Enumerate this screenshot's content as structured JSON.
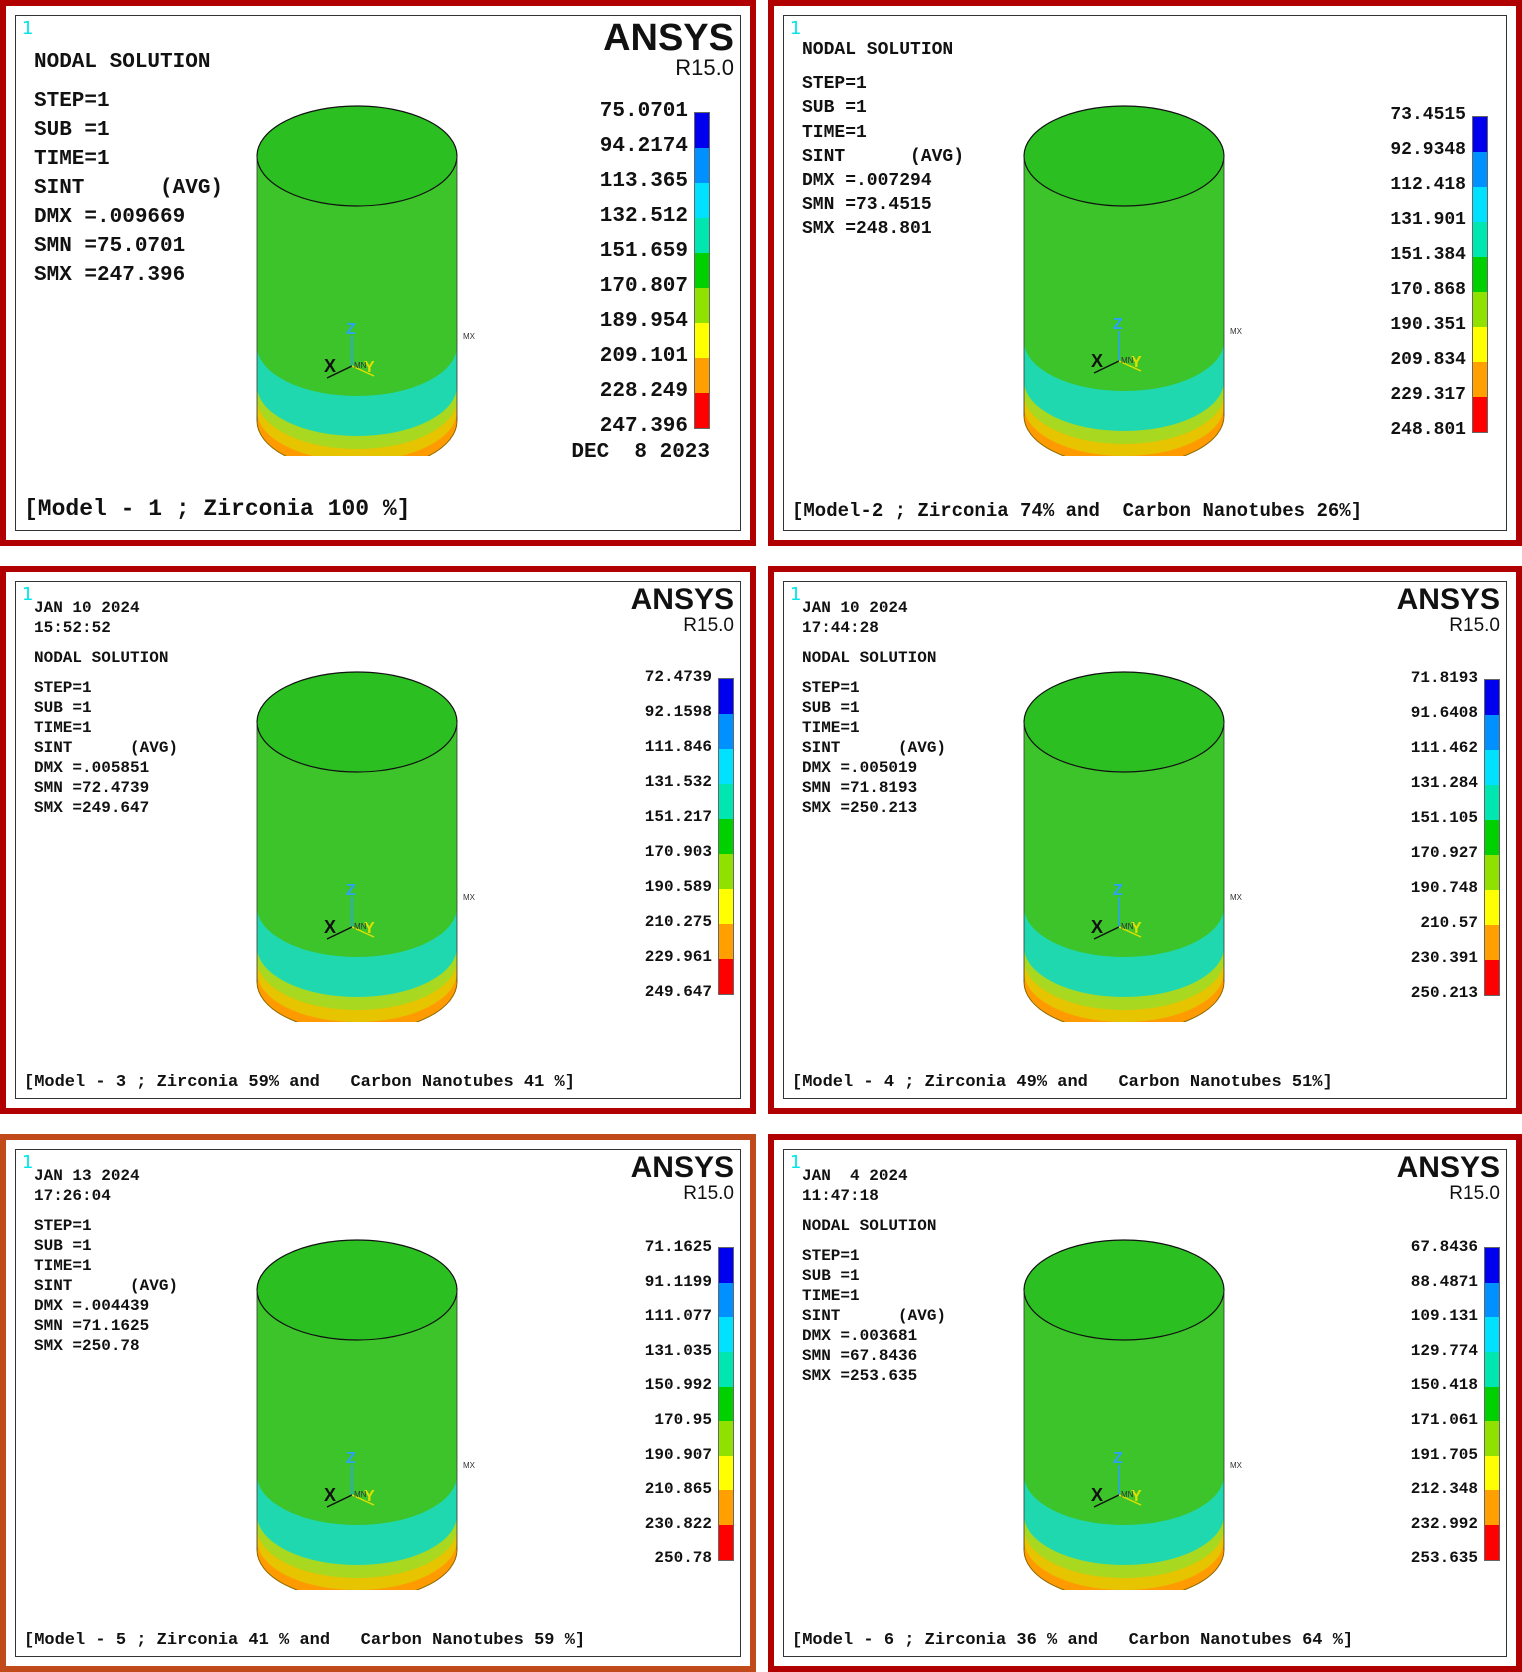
{
  "software": {
    "name": "ANSYS",
    "version": "R15.0",
    "window_number": "1"
  },
  "legend_colors": [
    "#0000ee",
    "#0090ff",
    "#00e0ff",
    "#00e6b0",
    "#00d000",
    "#90e000",
    "#ffff00",
    "#ffa000",
    "#ff0000"
  ],
  "panels": [
    {
      "id": "model-1",
      "date": "",
      "time": "",
      "title": "NODAL SOLUTION",
      "lines": [
        "STEP=1",
        "SUB =1",
        "TIME=1",
        "SINT      (AVG)",
        "DMX =.009669",
        "SMN =75.0701",
        "SMX =247.396"
      ],
      "legend": [
        "75.0701",
        "94.2174",
        "113.365",
        "132.512",
        "151.659",
        "170.807",
        "189.954",
        "209.101",
        "228.249",
        "247.396"
      ],
      "bottom_date": "DEC  8 2023",
      "caption": "[Model - 1 ; Zirconia 100 %]"
    },
    {
      "id": "model-2",
      "date": "",
      "time": "",
      "title": "NODAL SOLUTION",
      "lines": [
        "STEP=1",
        "SUB =1",
        "TIME=1",
        "SINT      (AVG)",
        "DMX =.007294",
        "SMN =73.4515",
        "SMX =248.801"
      ],
      "legend": [
        "73.4515",
        "92.9348",
        "112.418",
        "131.901",
        "151.384",
        "170.868",
        "190.351",
        "209.834",
        "229.317",
        "248.801"
      ],
      "bottom_date": "",
      "caption": "[Model-2 ; Zirconia 74% and  Carbon Nanotubes 26%]"
    },
    {
      "id": "model-3",
      "date": "JAN 10 2024",
      "time": "15:52:52",
      "title": "NODAL SOLUTION",
      "lines": [
        "STEP=1",
        "SUB =1",
        "TIME=1",
        "SINT      (AVG)",
        "DMX =.005851",
        "SMN =72.4739",
        "SMX =249.647"
      ],
      "legend": [
        "72.4739",
        "92.1598",
        "111.846",
        "131.532",
        "151.217",
        "170.903",
        "190.589",
        "210.275",
        "229.961",
        "249.647"
      ],
      "bottom_date": "",
      "caption": "[Model - 3 ; Zirconia 59% and   Carbon Nanotubes 41 %]"
    },
    {
      "id": "model-4",
      "date": "JAN 10 2024",
      "time": "17:44:28",
      "title": "NODAL SOLUTION",
      "lines": [
        "STEP=1",
        "SUB =1",
        "TIME=1",
        "SINT      (AVG)",
        "DMX =.005019",
        "SMN =71.8193",
        "SMX =250.213"
      ],
      "legend": [
        "71.8193",
        "91.6408",
        "111.462",
        "131.284",
        "151.105",
        "170.927",
        "190.748",
        "210.57",
        "230.391",
        "250.213"
      ],
      "bottom_date": "",
      "caption": "[Model - 4 ; Zirconia 49% and   Carbon Nanotubes 51%]"
    },
    {
      "id": "model-5",
      "date": "JAN 13 2024",
      "time": "17:26:04",
      "title": "",
      "lines": [
        "STEP=1",
        "SUB =1",
        "TIME=1",
        "SINT      (AVG)",
        "DMX =.004439",
        "SMN =71.1625",
        "SMX =250.78"
      ],
      "legend": [
        "71.1625",
        "91.1199",
        "111.077",
        "131.035",
        "150.992",
        "170.95",
        "190.907",
        "210.865",
        "230.822",
        "250.78"
      ],
      "bottom_date": "",
      "caption": "[Model - 5 ; Zirconia 41 % and   Carbon Nanotubes 59 %]"
    },
    {
      "id": "model-6",
      "date": "JAN  4 2024",
      "time": "11:47:18",
      "title": "NODAL SOLUTION",
      "lines": [
        "STEP=1",
        "SUB =1",
        "TIME=1",
        "SINT      (AVG)",
        "DMX =.003681",
        "SMN =67.8436",
        "SMX =253.635"
      ],
      "legend": [
        "67.8436",
        "88.4871",
        "109.131",
        "129.774",
        "150.418",
        "171.061",
        "191.705",
        "212.348",
        "232.992",
        "253.635"
      ],
      "bottom_date": "",
      "caption": "[Model - 6 ; Zirconia 36 % and   Carbon Nanotubes 64 %]"
    }
  ]
}
